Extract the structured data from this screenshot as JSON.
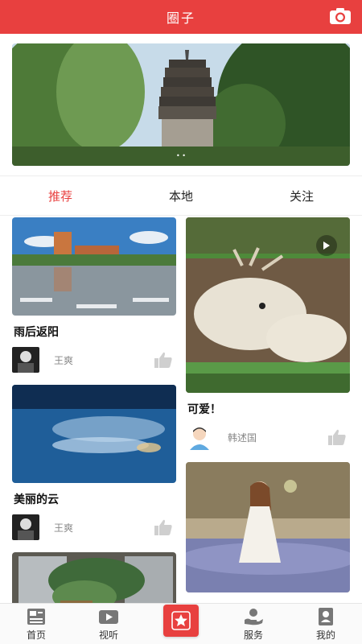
{
  "header": {
    "title": "圈子",
    "camera_icon": "camera-icon"
  },
  "banner": {
    "image": "pagoda-photo",
    "dots": "• •"
  },
  "tabs": [
    {
      "label": "推荐",
      "active": true
    },
    {
      "label": "本地",
      "active": false
    },
    {
      "label": "关注",
      "active": false
    }
  ],
  "feed": {
    "left": [
      {
        "title": "雨后返阳",
        "author": "王爽",
        "image": "rainy-street-photo"
      },
      {
        "title": "美丽的云",
        "author": "王爽",
        "image": "cloud-sky-photo"
      },
      {
        "title": "",
        "author": "",
        "image": "plants-window-photo"
      }
    ],
    "right": [
      {
        "title": "可爱！",
        "author": "韩述国",
        "image": "deer-video",
        "is_video": true
      },
      {
        "title": "",
        "author": "",
        "image": "girl-flower-field-photo"
      }
    ]
  },
  "bottom_nav": [
    {
      "label": "首页",
      "icon": "news-icon"
    },
    {
      "label": "视听",
      "icon": "video-icon"
    },
    {
      "label": "",
      "icon": "star-icon"
    },
    {
      "label": "服务",
      "icon": "service-icon"
    },
    {
      "label": "我的",
      "icon": "profile-icon"
    }
  ],
  "colors": {
    "accent": "#e8403f",
    "muted": "#888888"
  }
}
